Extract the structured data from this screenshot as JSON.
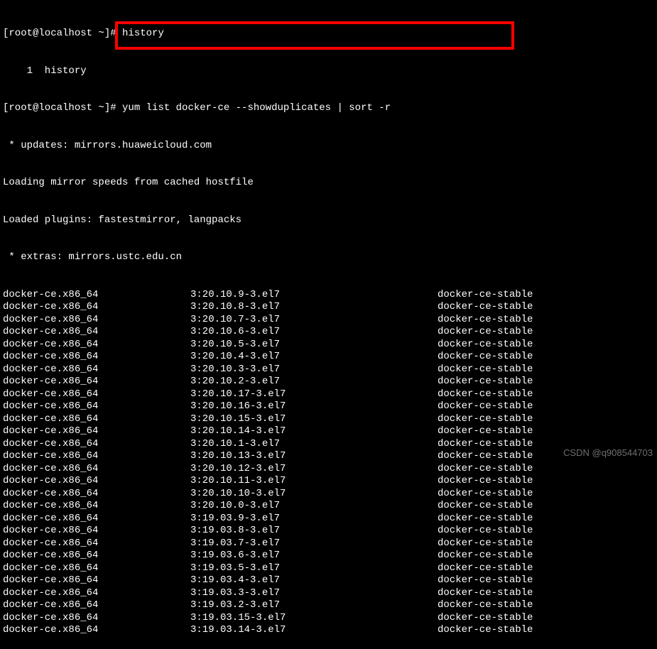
{
  "prompt1": "[root@localhost ~]# ",
  "cmd1": "history",
  "history_line": "    1  history",
  "prompt2": "[root@localhost ~]# ",
  "cmd2": "yum list docker-ce --showduplicates | sort -r",
  "updates_line": " * updates: mirrors.huaweicloud.com",
  "loading_line": "Loading mirror speeds from cached hostfile",
  "loaded_line": "Loaded plugins: fastestmirror, langpacks",
  "extras_line": " * extras: mirrors.ustc.edu.cn",
  "packages": [
    {
      "name": "docker-ce.x86_64",
      "version": "3:20.10.9-3.el7",
      "repo": "docker-ce-stable"
    },
    {
      "name": "docker-ce.x86_64",
      "version": "3:20.10.8-3.el7",
      "repo": "docker-ce-stable"
    },
    {
      "name": "docker-ce.x86_64",
      "version": "3:20.10.7-3.el7",
      "repo": "docker-ce-stable"
    },
    {
      "name": "docker-ce.x86_64",
      "version": "3:20.10.6-3.el7",
      "repo": "docker-ce-stable"
    },
    {
      "name": "docker-ce.x86_64",
      "version": "3:20.10.5-3.el7",
      "repo": "docker-ce-stable"
    },
    {
      "name": "docker-ce.x86_64",
      "version": "3:20.10.4-3.el7",
      "repo": "docker-ce-stable"
    },
    {
      "name": "docker-ce.x86_64",
      "version": "3:20.10.3-3.el7",
      "repo": "docker-ce-stable"
    },
    {
      "name": "docker-ce.x86_64",
      "version": "3:20.10.2-3.el7",
      "repo": "docker-ce-stable"
    },
    {
      "name": "docker-ce.x86_64",
      "version": "3:20.10.17-3.el7",
      "repo": "docker-ce-stable"
    },
    {
      "name": "docker-ce.x86_64",
      "version": "3:20.10.16-3.el7",
      "repo": "docker-ce-stable"
    },
    {
      "name": "docker-ce.x86_64",
      "version": "3:20.10.15-3.el7",
      "repo": "docker-ce-stable"
    },
    {
      "name": "docker-ce.x86_64",
      "version": "3:20.10.14-3.el7",
      "repo": "docker-ce-stable"
    },
    {
      "name": "docker-ce.x86_64",
      "version": "3:20.10.1-3.el7",
      "repo": "docker-ce-stable"
    },
    {
      "name": "docker-ce.x86_64",
      "version": "3:20.10.13-3.el7",
      "repo": "docker-ce-stable"
    },
    {
      "name": "docker-ce.x86_64",
      "version": "3:20.10.12-3.el7",
      "repo": "docker-ce-stable"
    },
    {
      "name": "docker-ce.x86_64",
      "version": "3:20.10.11-3.el7",
      "repo": "docker-ce-stable"
    },
    {
      "name": "docker-ce.x86_64",
      "version": "3:20.10.10-3.el7",
      "repo": "docker-ce-stable"
    },
    {
      "name": "docker-ce.x86_64",
      "version": "3:20.10.0-3.el7",
      "repo": "docker-ce-stable"
    },
    {
      "name": "docker-ce.x86_64",
      "version": "3:19.03.9-3.el7",
      "repo": "docker-ce-stable"
    },
    {
      "name": "docker-ce.x86_64",
      "version": "3:19.03.8-3.el7",
      "repo": "docker-ce-stable"
    },
    {
      "name": "docker-ce.x86_64",
      "version": "3:19.03.7-3.el7",
      "repo": "docker-ce-stable"
    },
    {
      "name": "docker-ce.x86_64",
      "version": "3:19.03.6-3.el7",
      "repo": "docker-ce-stable"
    },
    {
      "name": "docker-ce.x86_64",
      "version": "3:19.03.5-3.el7",
      "repo": "docker-ce-stable"
    },
    {
      "name": "docker-ce.x86_64",
      "version": "3:19.03.4-3.el7",
      "repo": "docker-ce-stable"
    },
    {
      "name": "docker-ce.x86_64",
      "version": "3:19.03.3-3.el7",
      "repo": "docker-ce-stable"
    },
    {
      "name": "docker-ce.x86_64",
      "version": "3:19.03.2-3.el7",
      "repo": "docker-ce-stable"
    },
    {
      "name": "docker-ce.x86_64",
      "version": "3:19.03.15-3.el7",
      "repo": "docker-ce-stable"
    },
    {
      "name": "docker-ce.x86_64",
      "version": "3:19.03.14-3.el7",
      "repo": "docker-ce-stable"
    }
  ],
  "watermark": "CSDN @q908544703"
}
